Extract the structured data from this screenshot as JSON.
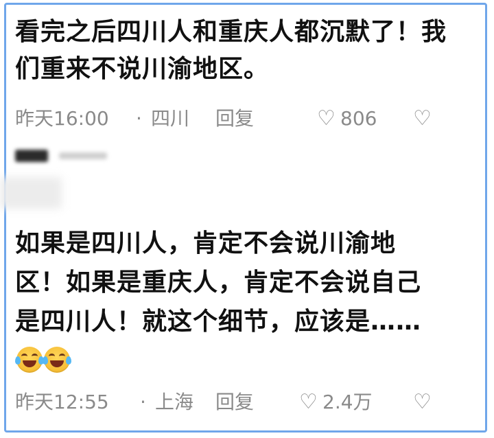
{
  "comments": [
    {
      "text": "看完之后四川人和重庆人都沉默了！我们重来不说川渝地区。",
      "time": "昨天16:00",
      "dot": "·",
      "location": "四川",
      "reply_label": "回复",
      "likes": "806",
      "like_icon": "heart-outline",
      "dislike_icon": "broken-heart-outline"
    },
    {
      "text": "如果是四川人，肯定不会说川渝地区！如果是重庆人，肯定不会说自己是四川人！就这个细节，应该是……",
      "emojis": [
        "laughing-crying-emoji",
        "laughing-crying-emoji"
      ],
      "time": "昨天12:55",
      "dot": "·",
      "location": "上海",
      "reply_label": "回复",
      "likes": "2.4万",
      "like_icon": "heart-outline",
      "dislike_icon": "broken-heart-outline"
    }
  ],
  "colors": {
    "frame_border": "#6fa6ea",
    "text": "#111111",
    "meta": "#8a8a8a"
  }
}
